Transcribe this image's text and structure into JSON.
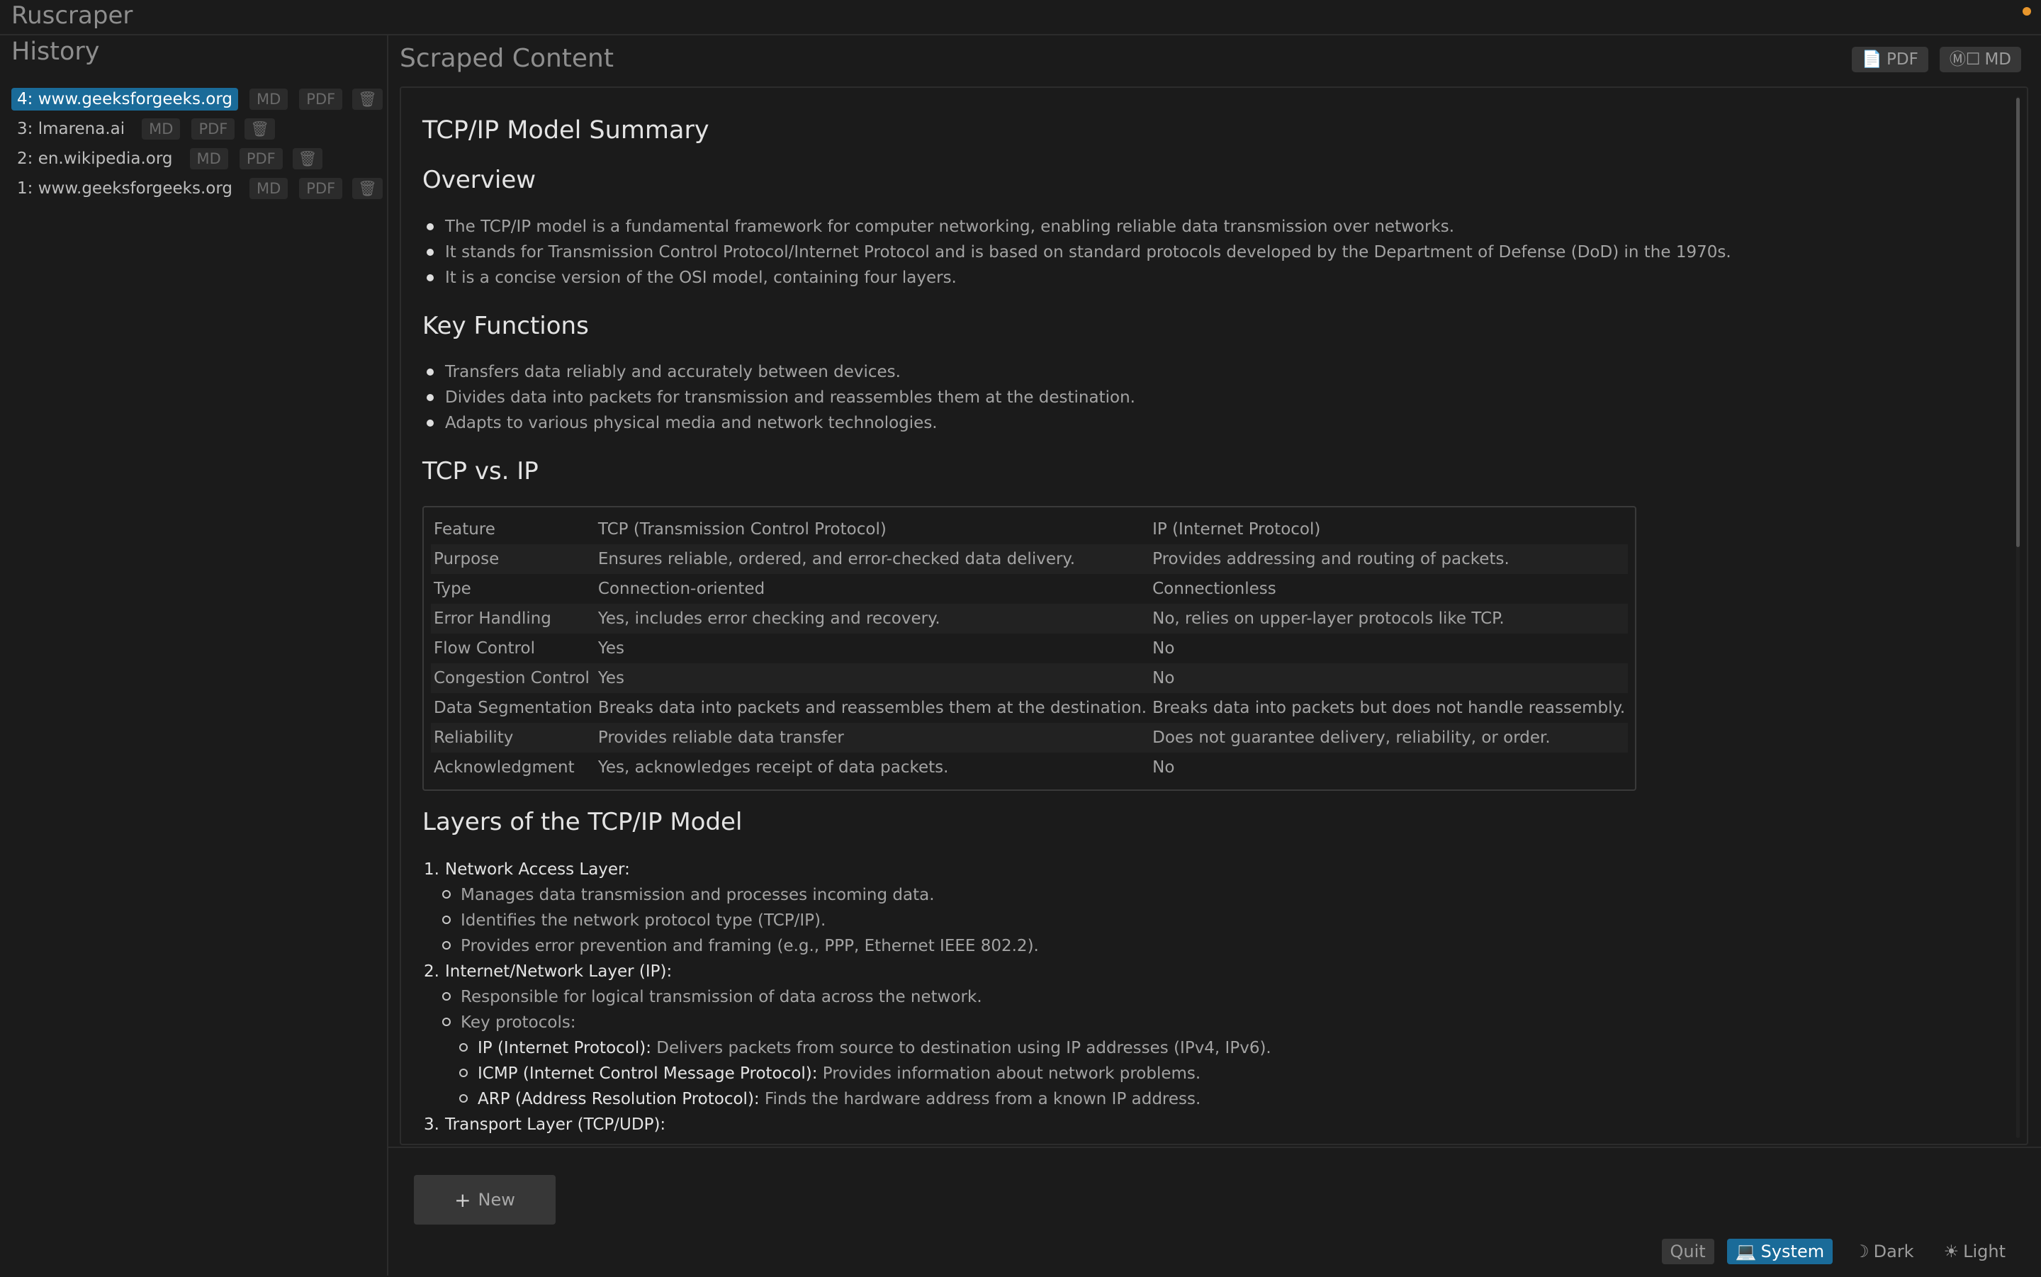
{
  "app": {
    "title": "Ruscraper"
  },
  "sidebar": {
    "title": "History",
    "items": [
      {
        "label": "4: www.geeksforgeeks.org",
        "md": "MD",
        "pdf": "PDF",
        "trash": "🗑",
        "active": true
      },
      {
        "label": "3: lmarena.ai",
        "md": "MD",
        "pdf": "PDF",
        "trash": "🗑",
        "active": false
      },
      {
        "label": "2: en.wikipedia.org",
        "md": "MD",
        "pdf": "PDF",
        "trash": "🗑",
        "active": false
      },
      {
        "label": "1: www.geeksforgeeks.org",
        "md": "MD",
        "pdf": "PDF",
        "trash": "🗑",
        "active": false
      }
    ]
  },
  "main": {
    "title": "Scraped Content",
    "export_pdf": "PDF",
    "export_pdf_icon": "📄",
    "export_md": "MD",
    "export_md_icon": "Ⓜ☐",
    "doc": {
      "h1": "TCP/IP Model Summary",
      "overview": {
        "heading": "Overview",
        "bullets": [
          "The TCP/IP model is a fundamental framework for computer networking, enabling reliable data transmission over networks.",
          "It stands for Transmission Control Protocol/Internet Protocol and is based on standard protocols developed by the Department of Defense (DoD) in the 1970s.",
          "It is a concise version of the OSI model, containing four layers."
        ]
      },
      "key_functions": {
        "heading": "Key Functions",
        "bullets": [
          "Transfers data reliably and accurately between devices.",
          "Divides data into packets for transmission and reassembles them at the destination.",
          "Adapts to various physical media and network technologies."
        ]
      },
      "tcp_vs_ip": {
        "heading": "TCP vs. IP",
        "rows": [
          [
            "Feature",
            "TCP (Transmission Control Protocol)",
            "IP (Internet Protocol)"
          ],
          [
            "Purpose",
            "Ensures reliable, ordered, and error-checked data delivery.",
            "Provides addressing and routing of packets."
          ],
          [
            "Type",
            "Connection-oriented",
            "Connectionless"
          ],
          [
            "Error Handling",
            "Yes, includes error checking and recovery.",
            "No, relies on upper-layer protocols like TCP."
          ],
          [
            "Flow Control",
            "Yes",
            "No"
          ],
          [
            "Congestion Control",
            "Yes",
            "No"
          ],
          [
            "Data Segmentation",
            "Breaks data into packets and reassembles them at the destination.",
            "Breaks data into packets but does not handle reassembly."
          ],
          [
            "Reliability",
            "Provides reliable data transfer",
            "Does not guarantee delivery, reliability, or order."
          ],
          [
            "Acknowledgment",
            "Yes, acknowledges receipt of data packets.",
            "No"
          ]
        ]
      },
      "layers": {
        "heading": "Layers of the TCP/IP Model",
        "l1_num": "1.",
        "l1_title": "Network Access Layer:",
        "l1_items": [
          "Manages data transmission and processes incoming data.",
          "Identifies the network protocol type (TCP/IP).",
          "Provides error prevention and framing (e.g., PPP, Ethernet IEEE 802.2)."
        ],
        "l2_num": "2.",
        "l2_title": "Internet/Network Layer (IP):",
        "l2_items": [
          "Responsible for logical transmission of data across the network.",
          "Key protocols:"
        ],
        "l2_protocols": [
          {
            "term": "IP (Internet Protocol):",
            "desc": " Delivers packets from source to destination using IP addresses (IPv4, IPv6)."
          },
          {
            "term": "ICMP (Internet Control Message Protocol):",
            "desc": " Provides information about network problems."
          },
          {
            "term": "ARP (Address Resolution Protocol):",
            "desc": " Finds the hardware address from a known IP address."
          }
        ],
        "l3_num": "3.",
        "l3_title": "Transport Layer (TCP/UDP):"
      }
    }
  },
  "footer": {
    "new_icon": "+",
    "new_label": "New",
    "quit": "Quit",
    "system_icon": "💻",
    "system": "System",
    "dark_icon": "☽",
    "dark": "Dark",
    "light_icon": "☀",
    "light": "Light"
  },
  "colors": {
    "accent": "#1a6b99",
    "status_dot": "#e8962c",
    "background": "#1b1b1b"
  }
}
